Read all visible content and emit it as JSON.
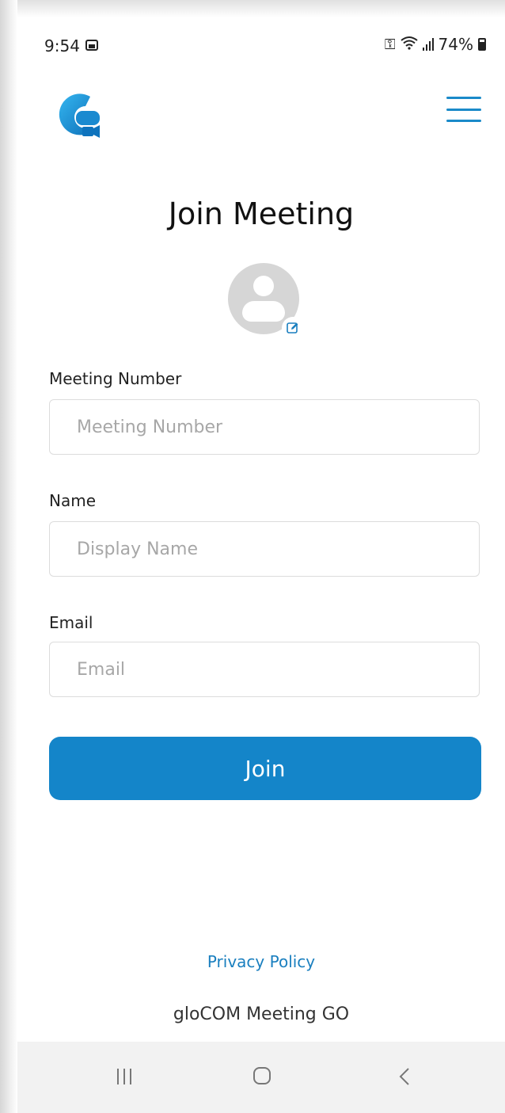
{
  "status_bar": {
    "time": "9:54",
    "battery": "74%",
    "icons": [
      "gallery-icon",
      "vpn-key-icon",
      "wifi-icon",
      "signal-icon",
      "battery-icon"
    ]
  },
  "header": {
    "logo_icon": "glocom-meeting-logo-icon",
    "menu_icon": "hamburger-menu-icon"
  },
  "page": {
    "title": "Join Meeting"
  },
  "avatar": {
    "icon": "user-avatar-icon",
    "edit_icon": "edit-icon"
  },
  "form": {
    "meeting_number": {
      "label": "Meeting Number",
      "placeholder": "Meeting Number",
      "value": ""
    },
    "name": {
      "label": "Name",
      "placeholder": "Display Name",
      "value": ""
    },
    "email": {
      "label": "Email",
      "placeholder": "Email",
      "value": ""
    },
    "join_label": "Join"
  },
  "footer": {
    "privacy_label": "Privacy Policy",
    "app_name": "gloCOM Meeting GO"
  },
  "colors": {
    "accent": "#1485c9",
    "link": "#1a7fbf",
    "avatar_bg": "#d6d6d6"
  }
}
